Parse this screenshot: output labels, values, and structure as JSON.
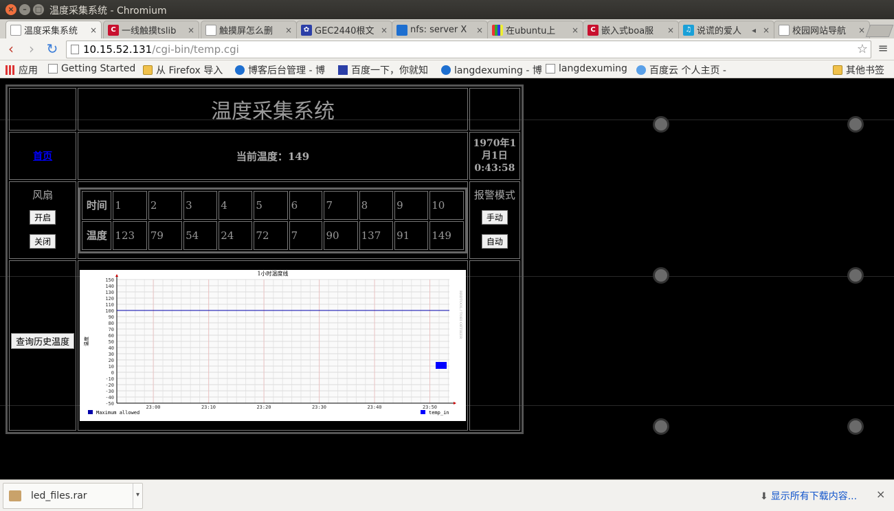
{
  "window": {
    "title": "温度采集系统 - Chromium"
  },
  "tabs": [
    {
      "label": "温度采集系统",
      "icon": "page-icon"
    },
    {
      "label": "一线触摸tslib",
      "icon": "c-logo-icon"
    },
    {
      "label": "触摸屏怎么删",
      "icon": "page-icon"
    },
    {
      "label": "GEC2440根文",
      "icon": "baidu-paw-icon"
    },
    {
      "label": "nfs: server X",
      "icon": "globe-icon"
    },
    {
      "label": "在ubuntu上",
      "icon": "multicolor-icon"
    },
    {
      "label": "嵌入式boa服",
      "icon": "c-logo-icon"
    },
    {
      "label": "说谎的爱人",
      "icon": "music-icon"
    },
    {
      "label": "校园网站导航",
      "icon": "page-icon"
    }
  ],
  "address": {
    "host": "10.15.52.131",
    "path": "/cgi-bin/temp.cgi"
  },
  "bookmarks": {
    "apps": "应用",
    "getting_started": "Getting Started",
    "firefox_import": "从 Firefox 导入",
    "blog_admin": "博客后台管理 - 博",
    "baidu": "百度一下，你就知",
    "langdexuming1": "langdexuming - 博",
    "langdexuming2": "langdexuming",
    "baiduyun": "百度云 个人主页 -",
    "other": "其他书签"
  },
  "page": {
    "title": "温度采集系统",
    "home_link": "首页",
    "current_temp": "当前温度：149",
    "datetime_line1": "1970年1",
    "datetime_line2": "月1日",
    "datetime_line3": "0:43:58",
    "fan_label": "风扇",
    "fan_on": "开启",
    "fan_off": "关闭",
    "alarm_label": "报警模式",
    "alarm_manual": "手动",
    "alarm_auto": "自动",
    "history_button": "查询历史温度",
    "table": {
      "time_header": "时间",
      "temp_header": "温度",
      "times": [
        "1",
        "2",
        "3",
        "4",
        "5",
        "6",
        "7",
        "8",
        "9",
        "10"
      ],
      "temps": [
        "123",
        "79",
        "54",
        "24",
        "72",
        "7",
        "90",
        "137",
        "91",
        "149"
      ]
    }
  },
  "chart_data": {
    "type": "line",
    "title": "1小时温度线",
    "ylabel": "温度",
    "right_label": "RRDTOOL / TOBI OETIKER",
    "ylim": [
      -50,
      150
    ],
    "y_ticks": [
      150,
      140,
      130,
      120,
      110,
      100,
      90,
      80,
      70,
      60,
      50,
      40,
      30,
      20,
      10,
      0,
      -10,
      -20,
      -30,
      -40,
      -50
    ],
    "x_ticks": [
      "23:00",
      "23:10",
      "23:20",
      "23:30",
      "23:40",
      "23:50"
    ],
    "series": [
      {
        "name": "Maximum allowed",
        "color": "#0000aa",
        "values": [
          100
        ]
      },
      {
        "name": "temp_in",
        "color": "#0000ff",
        "values": [
          10
        ]
      }
    ],
    "legend": "bottom"
  },
  "downloads": {
    "file": "led_files.rar",
    "show_all": "显示所有下载内容..."
  }
}
